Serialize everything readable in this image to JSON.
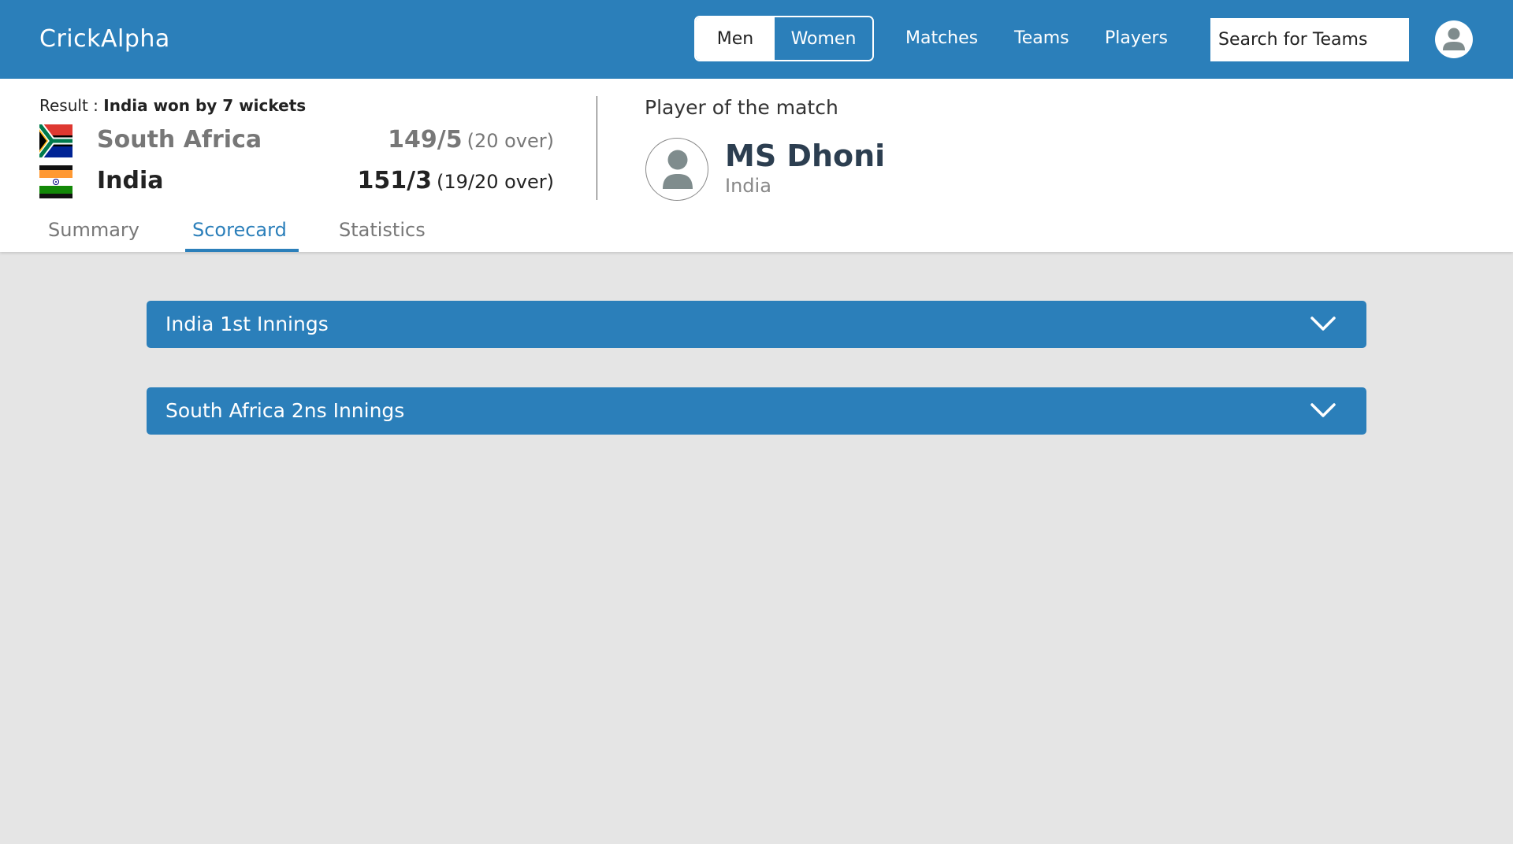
{
  "header": {
    "brand": "CrickAlpha",
    "gender": {
      "men_label": "Men",
      "women_label": "Women",
      "selected": "Men"
    },
    "nav": {
      "matches": "Matches",
      "teams": "Teams",
      "players": "Players"
    },
    "search_placeholder": "Search for Teams",
    "avatar_icon": "user-icon"
  },
  "match": {
    "result_label": "Result :",
    "result_text": "India won by 7 wickets",
    "teams": [
      {
        "name": "South Africa",
        "score": "149/5",
        "overs": "(20 over)",
        "flag_icon": "south-africa-flag-icon"
      },
      {
        "name": "India",
        "score": "151/3",
        "overs": "(19/20 over)",
        "flag_icon": "india-flag-icon"
      }
    ],
    "player_of_match": {
      "label": "Player of the match",
      "name": "MS Dhoni",
      "team": "India"
    }
  },
  "tabs": [
    {
      "label": "Summary"
    },
    {
      "label": "Scorecard"
    },
    {
      "label": "Statistics"
    }
  ],
  "active_tab": "Scorecard",
  "innings": [
    {
      "title": "India 1st Innings",
      "icon": "chevron-down-icon"
    },
    {
      "title": "South Africa 2ns Innings",
      "icon": "chevron-down-icon"
    }
  ],
  "colors": {
    "primary": "#2b7fba",
    "background": "#e5e5e5"
  }
}
